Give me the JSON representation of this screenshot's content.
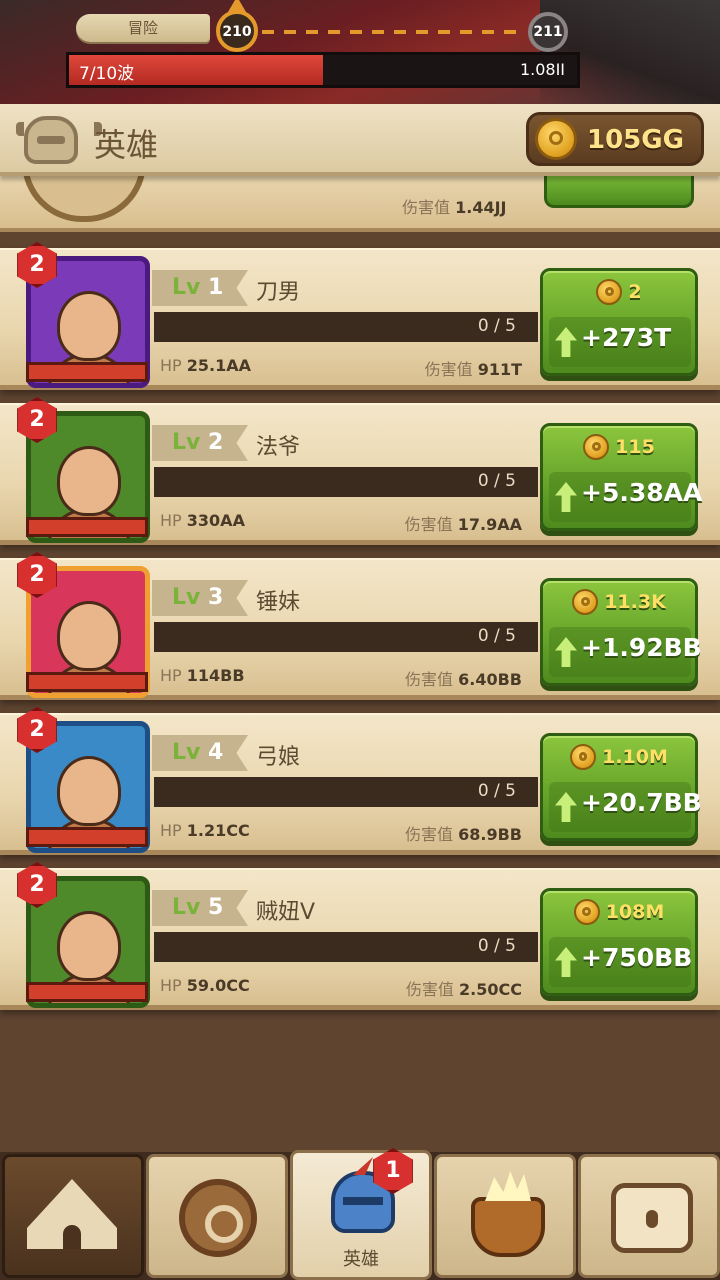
{
  "battle": {
    "mode_label": "冒险",
    "current_stage": "210",
    "next_stage": "211",
    "wave_label": "7/10波",
    "wave_progress": 0.5,
    "enemy_hp": "1.08II"
  },
  "header": {
    "title": "英雄",
    "gold": "105GG"
  },
  "partial_row": {
    "dmg_label": "伤害值",
    "dmg_value": "1.44JJ"
  },
  "heroes": [
    {
      "badge": "2",
      "lv_tag": "Lv",
      "lv": "1",
      "name": "刀男",
      "progress": "0 / 5",
      "hp_label": "HP",
      "hp": "25.1AA",
      "dmg_label": "伤害值",
      "dmg": "911T",
      "cost": "2",
      "gain": "+273T",
      "frame_color": "#7b3ab8",
      "frame_border": "#4a1a80"
    },
    {
      "badge": "2",
      "lv_tag": "Lv",
      "lv": "2",
      "name": "法爷",
      "progress": "0 / 5",
      "hp_label": "HP",
      "hp": "330AA",
      "dmg_label": "伤害值",
      "dmg": "17.9AA",
      "cost": "115",
      "gain": "+5.38AA",
      "frame_color": "#4e8a2a",
      "frame_border": "#2d5a14"
    },
    {
      "badge": "2",
      "lv_tag": "Lv",
      "lv": "3",
      "name": "锤妹",
      "progress": "0 / 5",
      "hp_label": "HP",
      "hp": "114BB",
      "dmg_label": "伤害值",
      "dmg": "6.40BB",
      "cost": "11.3K",
      "gain": "+1.92BB",
      "frame_color": "#d8365a",
      "frame_border": "#f0a030"
    },
    {
      "badge": "2",
      "lv_tag": "Lv",
      "lv": "4",
      "name": "弓娘",
      "progress": "0 / 5",
      "hp_label": "HP",
      "hp": "1.21CC",
      "dmg_label": "伤害值",
      "dmg": "68.9BB",
      "cost": "1.10M",
      "gain": "+20.7BB",
      "frame_color": "#3a8ac8",
      "frame_border": "#1e4e86"
    },
    {
      "badge": "2",
      "lv_tag": "Lv",
      "lv": "5",
      "name": "贼妞V",
      "progress": "0 / 5",
      "hp_label": "HP",
      "hp": "59.0CC",
      "dmg_label": "伤害值",
      "dmg": "2.50CC",
      "cost": "108M",
      "gain": "+750BB",
      "frame_color": "#4e8a2a",
      "frame_border": "#2d5a14"
    }
  ],
  "nav": {
    "tabs": [
      {
        "icon": "tent-icon",
        "label": ""
      },
      {
        "icon": "rune-icon",
        "label": ""
      },
      {
        "icon": "knight-helmet-icon",
        "label": "英雄",
        "badge": "1"
      },
      {
        "icon": "cauldron-icon",
        "label": ""
      },
      {
        "icon": "treasure-chest-icon",
        "label": ""
      }
    ]
  }
}
